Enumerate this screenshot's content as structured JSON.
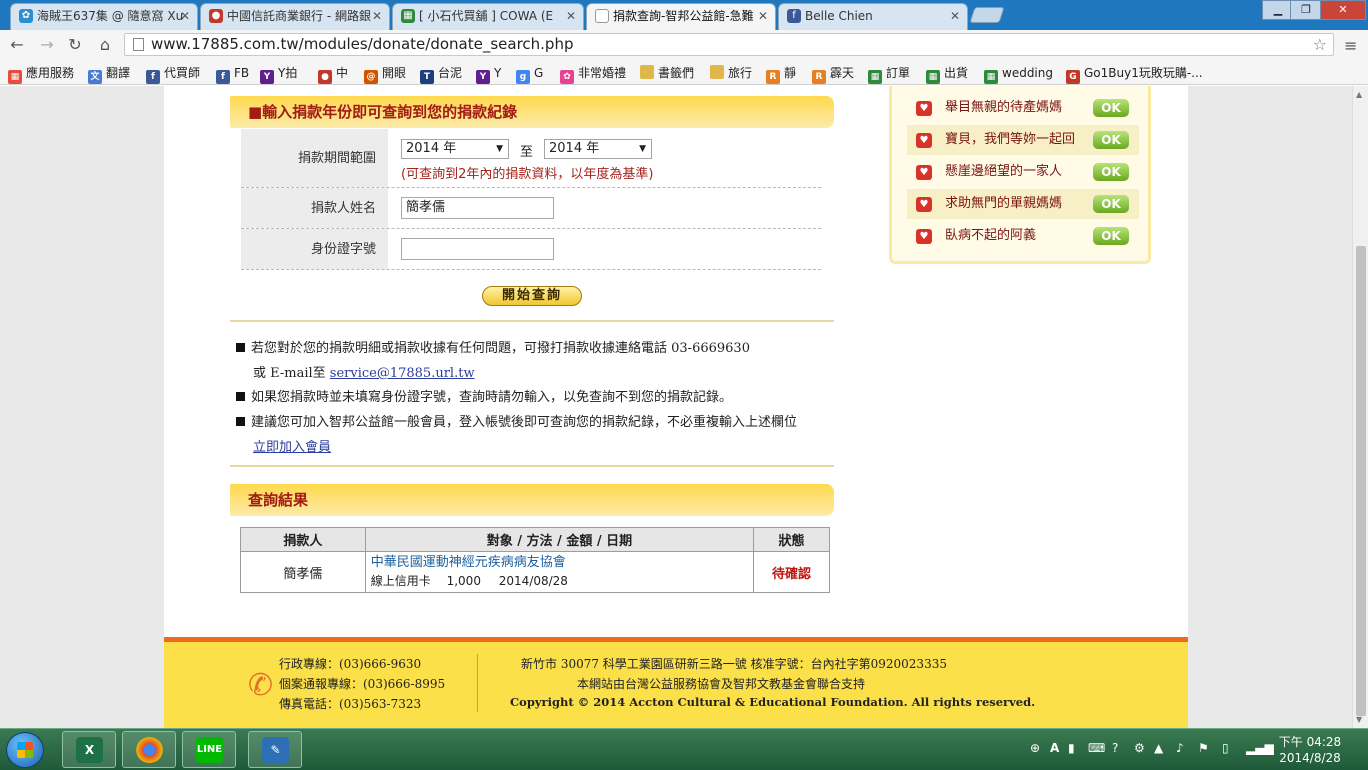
{
  "browser": {
    "tabs": [
      {
        "label": "海賊王637集 @ 隨意窩 Xu",
        "favicon_color": "#2a8fd0"
      },
      {
        "label": "中國信託商業銀行 - 網路銀",
        "favicon_color": "#c0392b"
      },
      {
        "label": "[ 小石代買舖 ] COWA (E",
        "favicon_color": "#2e8b3e"
      },
      {
        "label": "捐款查詢-智邦公益館-急難",
        "favicon_color": "#999999"
      },
      {
        "label": "Belle Chien",
        "favicon_color": "#3b5998"
      }
    ],
    "url": "www.17885.com.tw/modules/donate/donate_search.php",
    "bookmarks": [
      {
        "label": "應用服務",
        "icon": "apps-grid-icon",
        "color": "#e74c3c"
      },
      {
        "label": "翻譯",
        "icon": "translate-icon",
        "color": "#4a7bd0"
      },
      {
        "label": "代買師",
        "icon": "facebook-icon",
        "color": "#3b5998"
      },
      {
        "label": "FB",
        "icon": "facebook-icon",
        "color": "#3b5998"
      },
      {
        "label": "Y拍",
        "icon": "yahoo-icon",
        "color": "#5f1f8c"
      },
      {
        "label": "中",
        "icon": "ctbc-icon",
        "color": "#c0392b"
      },
      {
        "label": "開眼",
        "icon": "at-icon",
        "color": "#d35400"
      },
      {
        "label": "台泥",
        "icon": "tinyurl-icon",
        "color": "#1d3f7c"
      },
      {
        "label": "Y",
        "icon": "yahoo-icon",
        "color": "#5f1f8c"
      },
      {
        "label": "G",
        "icon": "google-icon",
        "color": "#4285f4"
      },
      {
        "label": "非常婚禮",
        "icon": "flower-icon",
        "color": "#e84393"
      },
      {
        "label": "書籤們",
        "icon": "folder-icon",
        "color": "#e0b84a"
      },
      {
        "label": "旅行",
        "icon": "folder-icon",
        "color": "#e0b84a"
      },
      {
        "label": "靜",
        "icon": "rakuten-icon",
        "color": "#e67e22"
      },
      {
        "label": "霹天",
        "icon": "rakuten-icon",
        "color": "#e67e22"
      },
      {
        "label": "訂單",
        "icon": "sheets-icon",
        "color": "#2e8b3e"
      },
      {
        "label": "出貨",
        "icon": "sheets-icon",
        "color": "#2e8b3e"
      },
      {
        "label": "wedding",
        "icon": "sheets-icon",
        "color": "#2e8b3e"
      },
      {
        "label": "Go1Buy1玩敗玩購-...",
        "icon": "go1buy1-icon",
        "color": "#c0392b"
      }
    ]
  },
  "search_form": {
    "heading": "■輸入捐款年份即可查詢到您的捐款紀錄",
    "period_label": "捐款期間範圍",
    "year_from": "2014 年",
    "to_label": "至",
    "year_to": "2014 年",
    "hint": "(可查詢到2年內的捐款資料，以年度為基準)",
    "name_label": "捐款人姓名",
    "name_value": "簡孝儒",
    "id_label": "身份證字號",
    "id_value": "",
    "submit_label": "開始查詢"
  },
  "notes": {
    "line1": "若您對於您的捐款明細或捐款收據有任何問題，可撥打捐款收據連絡電話 03-6669630",
    "line1b_prefix": "或 E-mail至",
    "email": "service@17885.url.tw",
    "line2": "如果您捐款時並未填寫身份證字號，查詢時請勿輸入，以免查詢不到您的捐款記錄。",
    "line3": "建議您可加入智邦公益館一般會員，登入帳號後即可查詢您的捐款紀錄，不必重複輸入上述欄位",
    "join_link": "立即加入會員"
  },
  "results": {
    "heading": "查詢結果",
    "columns": [
      "捐款人",
      "對象 / 方法 / 金額 / 日期",
      "狀態"
    ],
    "rows": [
      {
        "donor": "簡孝儒",
        "target": "中華民國運動神經元疾病病友協會",
        "method": "線上信用卡",
        "amount": "1,000",
        "date": "2014/08/28",
        "status": "待確認"
      }
    ]
  },
  "sidebar": {
    "items": [
      {
        "label": "舉目無親的待產媽媽",
        "button": "OK"
      },
      {
        "label": "寶貝，我們等妳一起回",
        "button": "OK"
      },
      {
        "label": "懸崖邊絕望的一家人",
        "button": "OK"
      },
      {
        "label": "求助無門的單親媽媽",
        "button": "OK"
      },
      {
        "label": "臥病不起的阿義",
        "button": "OK"
      }
    ]
  },
  "footer": {
    "hotline": "行政專線：(03)666-9630",
    "report_line": "個案通報專線：(03)666-8995",
    "fax": "傳真電話：(03)563-7323",
    "address": "新竹市 30077 科學工業園區研新三路一號 核准字號：台內社字第0920023335",
    "support": "本網站由台灣公益服務協會及智邦文教基金會聯合支持",
    "copyright": "Copyright © 2014 Accton Cultural & Educational Foundation. All rights reserved."
  },
  "taskbar": {
    "apps": [
      {
        "name": "excel",
        "glyph": "X",
        "color": "#1e7145"
      },
      {
        "name": "chrome",
        "glyph": "◉",
        "color": "#dd4b39"
      },
      {
        "name": "line",
        "glyph": "LINE",
        "color": "#00b900"
      },
      {
        "name": "tool",
        "glyph": "✎",
        "color": "#2d6fb5"
      }
    ],
    "ime": "A",
    "time": "下午 04:28",
    "date": "2014/8/28"
  }
}
